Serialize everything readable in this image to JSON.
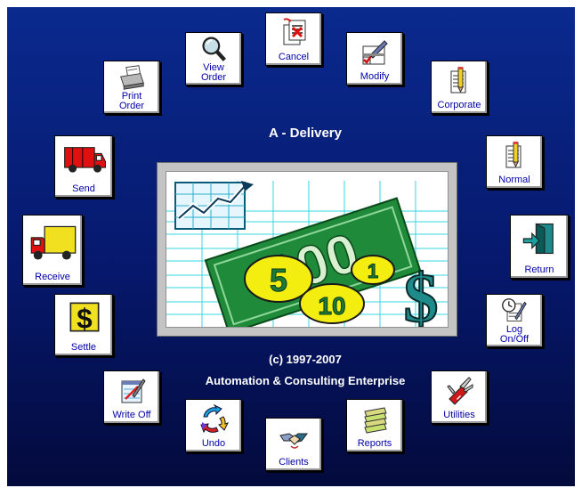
{
  "app": {
    "title": "A - Delivery",
    "copyright": "(c) 1997-2007",
    "company": "Automation & Consulting Enterprise"
  },
  "buttons": {
    "cancel": {
      "label": "Cancel",
      "icon": "cancel-document-icon"
    },
    "view_order": {
      "label": "View\nOrder",
      "icon": "magnifier-icon"
    },
    "modify": {
      "label": "Modify",
      "icon": "edit-checklist-icon"
    },
    "print_order": {
      "label": "Print\nOrder",
      "icon": "printer-icon"
    },
    "corporate": {
      "label": "Corporate",
      "icon": "notepad-pencil-icon"
    },
    "send": {
      "label": "Send",
      "icon": "red-van-icon"
    },
    "normal": {
      "label": "Normal",
      "icon": "notepad-pencil-icon"
    },
    "receive": {
      "label": "Receive",
      "icon": "yellow-truck-icon"
    },
    "return": {
      "label": "Return",
      "icon": "door-exit-icon"
    },
    "settle": {
      "label": "Settle",
      "icon": "dollar-sign-icon"
    },
    "log_onoff": {
      "label": "Log\nOn/Off",
      "icon": "clock-notepad-icon"
    },
    "write_off": {
      "label": "Write Off",
      "icon": "notepad-strike-icon"
    },
    "utilities": {
      "label": "Utilities",
      "icon": "swiss-knife-icon"
    },
    "undo": {
      "label": "Undo",
      "icon": "circular-arrows-icon"
    },
    "reports": {
      "label": "Reports",
      "icon": "stacked-papers-icon"
    },
    "clients": {
      "label": "Clients",
      "icon": "handshake-icon"
    }
  },
  "logo": {
    "bill_text": "100",
    "coins": [
      "5",
      "10",
      "1"
    ],
    "symbol": "$"
  },
  "colors": {
    "background_top": "#0a2a8e",
    "background_bottom": "#030a3c",
    "label_text": "#0000a8",
    "bill_green": "#1f8a3a",
    "coin_yellow": "#f4ee10",
    "grid_cyan": "#34d8e0"
  }
}
